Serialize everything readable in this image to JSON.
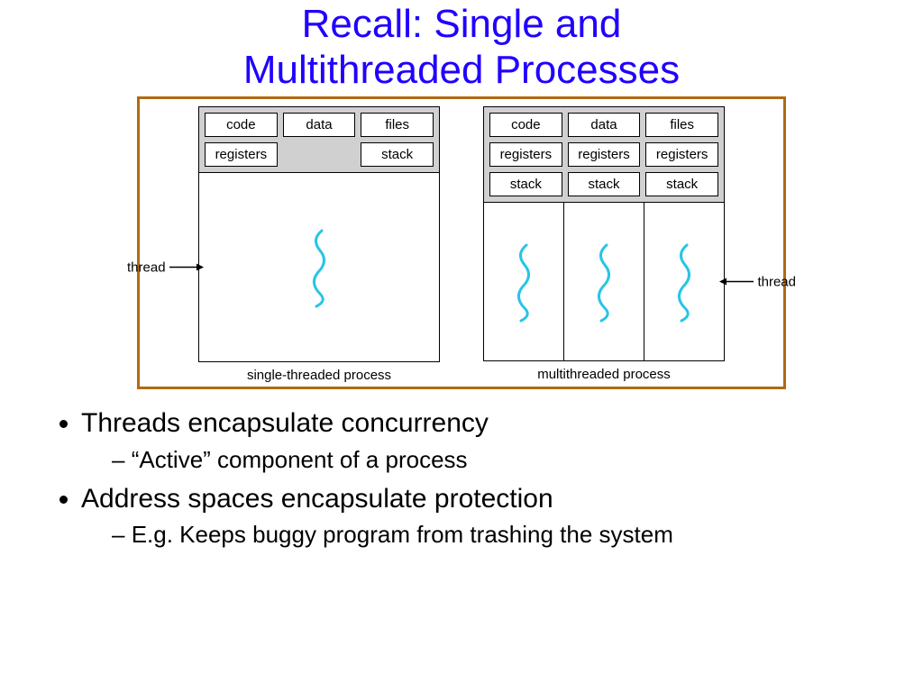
{
  "title_line1": "Recall: Single and",
  "title_line2": "Multithreaded Processes",
  "single": {
    "shared": [
      "code",
      "data",
      "files"
    ],
    "per_thread_row": [
      "registers",
      "",
      "stack"
    ],
    "thread_label": "thread",
    "caption": "single-threaded process"
  },
  "multi": {
    "shared": [
      "code",
      "data",
      "files"
    ],
    "registers_row": [
      "registers",
      "registers",
      "registers"
    ],
    "stack_row": [
      "stack",
      "stack",
      "stack"
    ],
    "thread_label": "thread",
    "caption": "multithreaded process"
  },
  "bullets": {
    "b1": "Threads encapsulate concurrency",
    "b1a": "“Active” component of a process",
    "b2": "Address spaces encapsulate protection",
    "b2a": "E.g. Keeps buggy program from trashing the system"
  }
}
